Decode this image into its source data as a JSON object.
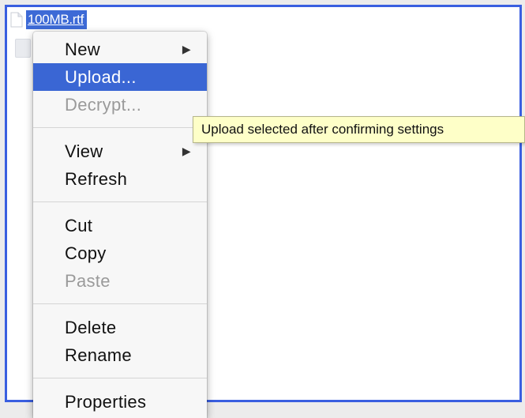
{
  "file": {
    "name": "100MB.rtf",
    "icon": "document-icon"
  },
  "menu": {
    "items": [
      {
        "label": "New",
        "submenu": true,
        "disabled": false,
        "highlighted": false
      },
      {
        "label": "Upload...",
        "submenu": false,
        "disabled": false,
        "highlighted": true
      },
      {
        "label": "Decrypt...",
        "submenu": false,
        "disabled": true,
        "highlighted": false
      },
      {
        "label": "View",
        "submenu": true,
        "disabled": false,
        "highlighted": false
      },
      {
        "label": "Refresh",
        "submenu": false,
        "disabled": false,
        "highlighted": false
      },
      {
        "label": "Cut",
        "submenu": false,
        "disabled": false,
        "highlighted": false
      },
      {
        "label": "Copy",
        "submenu": false,
        "disabled": false,
        "highlighted": false
      },
      {
        "label": "Paste",
        "submenu": false,
        "disabled": true,
        "highlighted": false
      },
      {
        "label": "Delete",
        "submenu": false,
        "disabled": false,
        "highlighted": false
      },
      {
        "label": "Rename",
        "submenu": false,
        "disabled": false,
        "highlighted": false
      },
      {
        "label": "Properties",
        "submenu": false,
        "disabled": false,
        "highlighted": false
      }
    ],
    "submenu_arrow": "▶"
  },
  "tooltip": {
    "text": "Upload selected after confirming settings"
  },
  "colors": {
    "selection": "#3a66d4",
    "panel_border": "#3a5fe0",
    "tooltip_bg": "#feffc8",
    "disabled_text": "#9a9a9a"
  }
}
